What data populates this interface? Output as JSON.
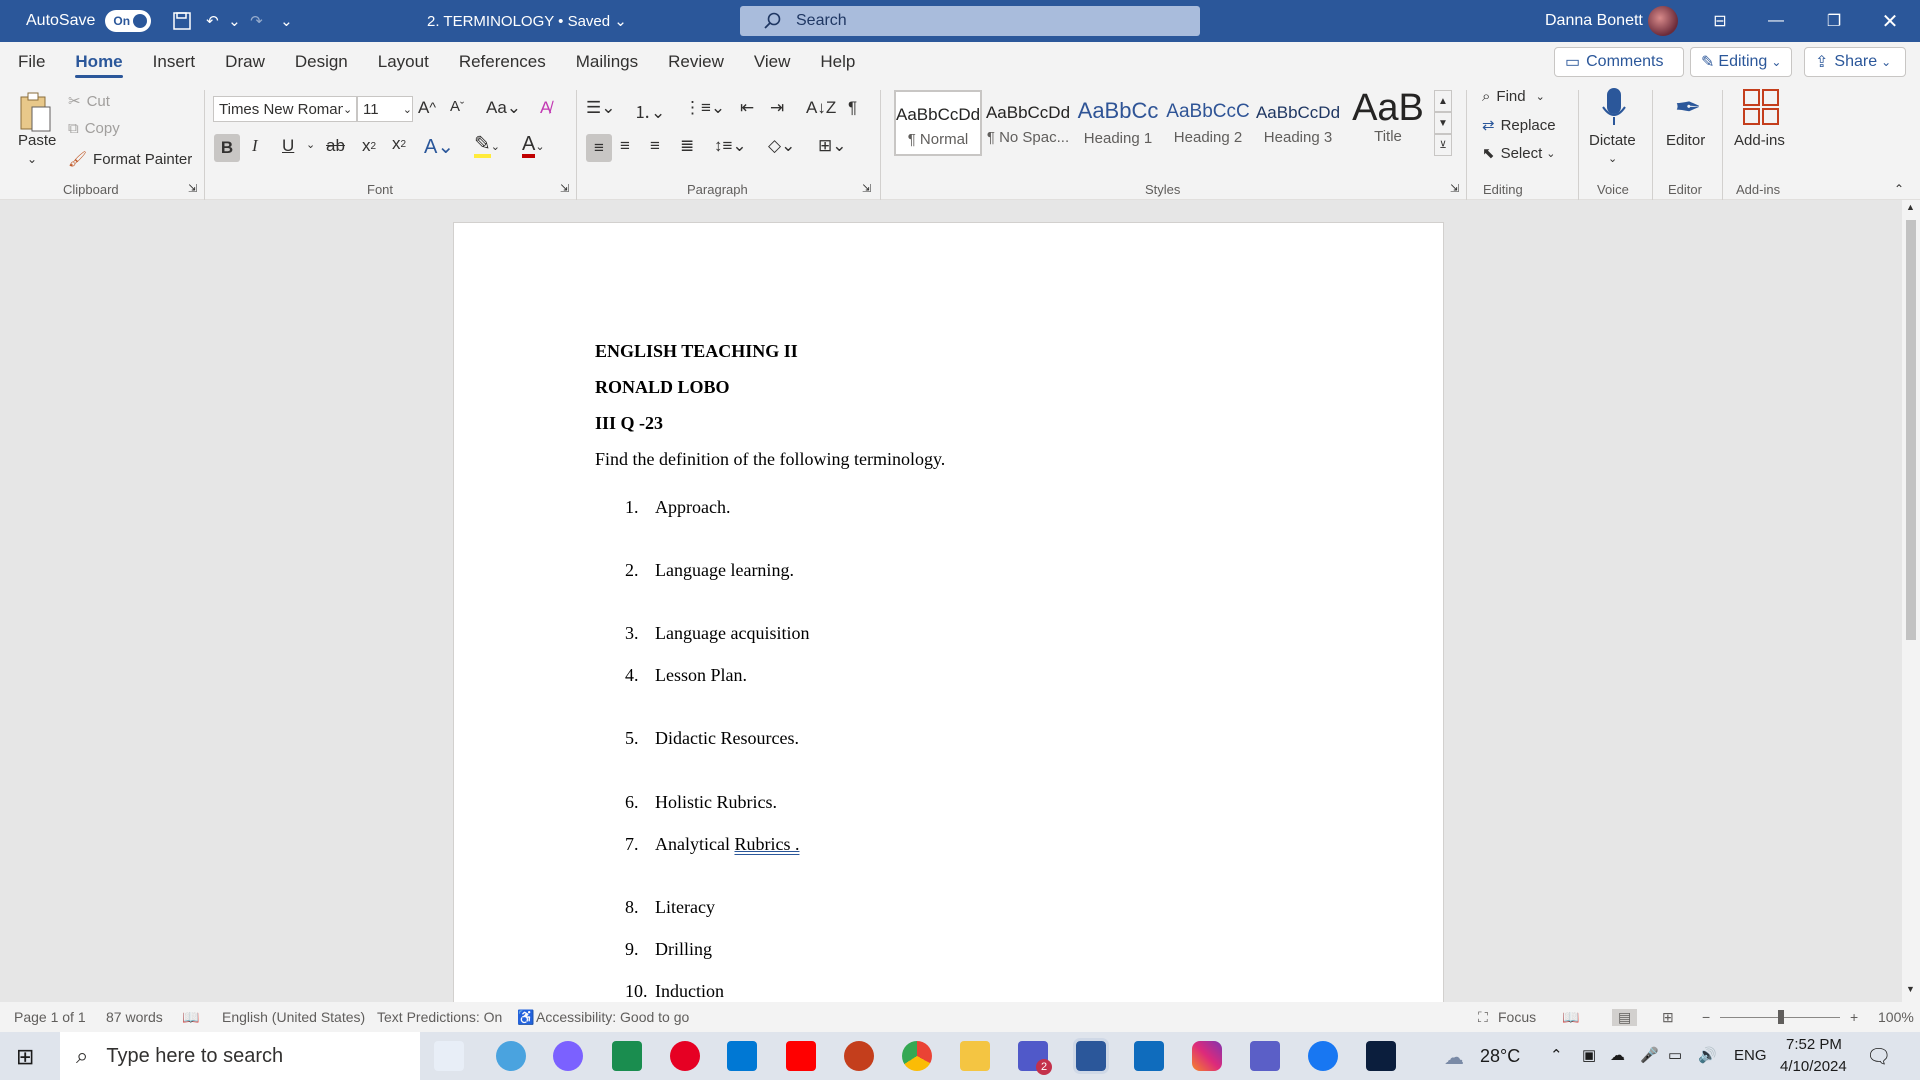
{
  "titlebar": {
    "autosave": "AutoSave",
    "toggle": "On",
    "doc_title": "2. TERMINOLOGY • Saved",
    "search": "Search",
    "user": "Danna Bonett"
  },
  "menu": {
    "tabs": [
      "File",
      "Home",
      "Insert",
      "Draw",
      "Design",
      "Layout",
      "References",
      "Mailings",
      "Review",
      "View",
      "Help"
    ],
    "comments": "Comments",
    "editing": "Editing",
    "share": "Share"
  },
  "clipboard": {
    "paste": "Paste",
    "cut": "Cut",
    "copy": "Copy",
    "format_painter": "Format Painter",
    "label": "Clipboard"
  },
  "font": {
    "name": "Times New Roman",
    "size": "11",
    "label": "Font"
  },
  "paragraph": {
    "label": "Paragraph"
  },
  "styles": {
    "label": "Styles",
    "items": [
      {
        "preview": "AaBbCcDd",
        "name": "¶ Normal"
      },
      {
        "preview": "AaBbCcDd",
        "name": "¶ No Spac..."
      },
      {
        "preview": "AaBbCc",
        "name": "Heading 1"
      },
      {
        "preview": "AaBbCcC",
        "name": "Heading 2"
      },
      {
        "preview": "AaBbCcDd",
        "name": "Heading 3"
      },
      {
        "preview": "AaB",
        "name": "Title"
      }
    ]
  },
  "editing": {
    "find": "Find",
    "replace": "Replace",
    "select": "Select",
    "label": "Editing"
  },
  "voice": {
    "dictate": "Dictate",
    "label": "Voice"
  },
  "editor": {
    "editor": "Editor",
    "label": "Editor"
  },
  "addins": {
    "addins": "Add-ins",
    "label": "Add-ins"
  },
  "document": {
    "lines": [
      "ENGLISH TEACHING II",
      "RONALD LOBO",
      "III Q -23",
      "Find the definition of the following terminology."
    ],
    "list": [
      {
        "n": "1.",
        "t": "Approach."
      },
      {
        "n": "2.",
        "t": "Language learning."
      },
      {
        "n": "3.",
        "t": "Language acquisition"
      },
      {
        "n": "4.",
        "t": "Lesson Plan."
      },
      {
        "n": "5.",
        "t": "Didactic Resources."
      },
      {
        "n": "6.",
        "t": "Holistic Rubrics."
      },
      {
        "n": "7.",
        "t": "Analytical ",
        "u": "Rubrics ."
      },
      {
        "n": "8.",
        "t": "Literacy"
      },
      {
        "n": "9.",
        "t": "Drilling"
      },
      {
        "n": "10.",
        "t": "Induction"
      }
    ]
  },
  "status": {
    "page": "Page 1 of 1",
    "words": "87 words",
    "language": "English (United States)",
    "predictions": "Text Predictions: On",
    "accessibility": "Accessibility: Good to go",
    "focus": "Focus",
    "zoom": "100%"
  },
  "taskbar": {
    "search": "Type here to search",
    "weather": "28°C",
    "lang": "ENG",
    "time": "7:52 PM",
    "date": "4/10/2024",
    "teams_badge": "2"
  }
}
